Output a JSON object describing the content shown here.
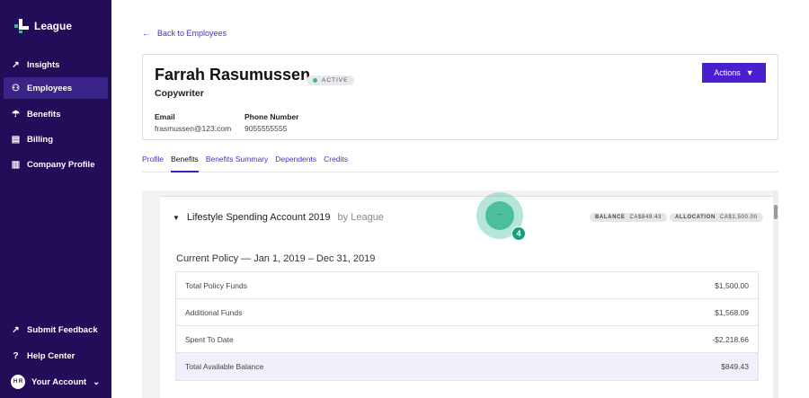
{
  "app": {
    "brand": "League"
  },
  "sidebar": {
    "items": [
      {
        "label": "Insights",
        "icon": "trend-icon"
      },
      {
        "label": "Employees",
        "icon": "people-icon",
        "active": true
      },
      {
        "label": "Benefits",
        "icon": "umbrella-icon"
      },
      {
        "label": "Billing",
        "icon": "card-icon"
      },
      {
        "label": "Company Profile",
        "icon": "building-icon"
      }
    ],
    "bottom": [
      {
        "label": "Submit Feedback",
        "icon": "external-icon"
      },
      {
        "label": "Help Center",
        "icon": "help-icon"
      }
    ],
    "account": {
      "initials": "H R",
      "label": "Your Account"
    }
  },
  "back_link": "Back to Employees",
  "employee": {
    "name": "Farrah Rasumussen",
    "status": "ACTIVE",
    "title": "Copywriter",
    "email_label": "Email",
    "email": "frasmussen@123.com",
    "phone_label": "Phone Number",
    "phone": "9055555555",
    "actions_label": "Actions"
  },
  "tabs": [
    "Profile",
    "Benefits",
    "Benefits Summary",
    "Dependents",
    "Credits"
  ],
  "active_tab": "Benefits",
  "benefit": {
    "name": "Lifestyle Spending Account 2019",
    "by": "by League",
    "balance_label": "BALANCE",
    "balance": "CA$849.43",
    "allocation_label": "ALLOCATION",
    "allocation": "CA$1,500.00",
    "policy": "Current Policy — Jan 1, 2019 – Dec 31, 2019",
    "rows": [
      {
        "label": "Total Policy Funds",
        "value": "$1,500.00"
      },
      {
        "label": "Additional Funds",
        "value": "$1,568.09"
      },
      {
        "label": "Spent To Date",
        "value": "-$2,218.66"
      },
      {
        "label": "Total Available Balance",
        "value": "$849.43"
      }
    ]
  },
  "overlay": {
    "dots": "•••",
    "count": "4"
  },
  "colors": {
    "sidebar": "#240d58",
    "accent": "#4a1fcf",
    "teal": "#17a07c"
  }
}
